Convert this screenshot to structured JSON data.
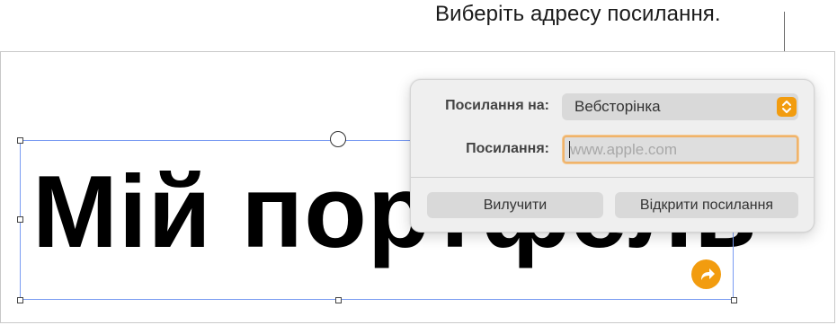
{
  "callout": {
    "text": "Виберіть адресу посилання."
  },
  "document": {
    "title_text": "Мій портфель"
  },
  "link_popover": {
    "link_to_label": "Посилання на:",
    "link_to_value": "Вебсторінка",
    "link_label": "Посилання:",
    "link_placeholder": "www.apple.com",
    "link_value": "",
    "remove_button": "Вилучити",
    "open_link_button": "Відкрити посилання"
  },
  "colors": {
    "accent": "#f29c0f",
    "selection_border": "#7a9cf2",
    "focus_ring": "#f0b36a"
  },
  "icons": {
    "select_stepper": "chevron-up-down-icon",
    "link_badge": "curved-arrow-icon"
  }
}
